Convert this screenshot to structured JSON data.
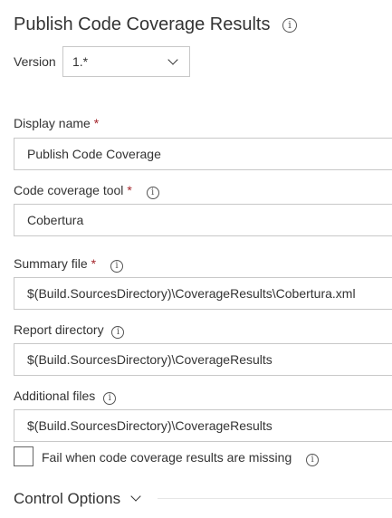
{
  "header": {
    "title": "Publish Code Coverage Results"
  },
  "version": {
    "label": "Version",
    "value": "1.*"
  },
  "fields": {
    "display_name": {
      "label": "Display name",
      "required_mark": "*",
      "value": "Publish Code Coverage"
    },
    "code_coverage_tool": {
      "label": "Code coverage tool",
      "required_mark": "*",
      "value": "Cobertura"
    },
    "summary_file": {
      "label": "Summary file",
      "required_mark": "*",
      "value": "$(Build.SourcesDirectory)\\CoverageResults\\Cobertura.xml"
    },
    "report_directory": {
      "label": "Report directory",
      "value": "$(Build.SourcesDirectory)\\CoverageResults"
    },
    "additional_files": {
      "label": "Additional files",
      "value": "$(Build.SourcesDirectory)\\CoverageResults"
    }
  },
  "checkbox": {
    "label": "Fail when code coverage results are missing",
    "checked": false
  },
  "control_options": {
    "label": "Control Options"
  },
  "icons": {
    "info": "i"
  },
  "colors": {
    "required": "#a4262c",
    "border": "#c8c8c8",
    "text": "#333333"
  }
}
